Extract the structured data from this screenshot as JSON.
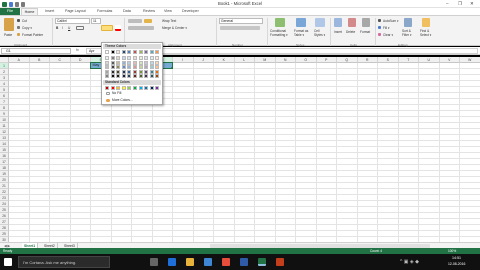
{
  "app": {
    "title": "Book1 - Microsoft Excel"
  },
  "window_controls": {
    "minimize": "–",
    "restore": "❐",
    "close": "✕"
  },
  "ribbon_tabs": [
    "File",
    "Home",
    "Insert",
    "Page Layout",
    "Formulas",
    "Data",
    "Review",
    "View",
    "Developer"
  ],
  "ribbon": {
    "clipboard": {
      "paste": "Paste",
      "cut": "Cut",
      "copy": "Copy ▾",
      "format_painter": "Format Painter",
      "group": "Clipboard"
    },
    "font": {
      "name": "Calibri",
      "size": "11",
      "bold": "B",
      "italic": "I",
      "underline": "U",
      "group": "Font"
    },
    "alignment": {
      "wrap": "Wrap Text",
      "merge": "Merge & Center ▾",
      "group": "Alignment"
    },
    "number": {
      "format": "General",
      "group": "Number"
    },
    "styles": {
      "conditional": "Conditional Formatting ▾",
      "format_table": "Format as Table ▾",
      "cell_styles": "Cell Styles ▾",
      "group": "Styles"
    },
    "cells": {
      "insert": "Insert",
      "delete": "Delete",
      "format": "Format",
      "group": "Cells"
    },
    "editing": {
      "autosum": "AutoSum ▾",
      "fill": "Fill ▾",
      "clear": "Clear ▾",
      "sort": "Sort & Filter ▾",
      "find": "Find & Select ▾",
      "group": "Editing"
    }
  },
  "formula_bar": {
    "name_box": "G1",
    "fx": "fx",
    "value": "Apr"
  },
  "columns": [
    "A",
    "B",
    "C",
    "D",
    "E",
    "F",
    "G",
    "H",
    "I",
    "J",
    "K",
    "L",
    "M",
    "N",
    "O",
    "P",
    "Q",
    "R",
    "S",
    "T",
    "U",
    "V",
    "W"
  ],
  "rows": [
    "1",
    "2",
    "3",
    "4",
    "5",
    "6",
    "7",
    "8",
    "9",
    "10",
    "11",
    "12",
    "13",
    "14",
    "15",
    "16",
    "17",
    "18",
    "19",
    "20",
    "21",
    "22",
    "23",
    "24",
    "25",
    "26",
    "27",
    "28",
    "29",
    "30"
  ],
  "cells": {
    "E1": "May",
    "F1": "Jun",
    "G1": "Jul",
    "H1": "Aug"
  },
  "palette": {
    "theme_header": "Theme Colors",
    "standard_header": "Standard Colors",
    "no_fill": "No Fill",
    "more_colors": "More Colors...",
    "theme_base": [
      "#ffffff",
      "#000000",
      "#eeece1",
      "#1f497d",
      "#4f81bd",
      "#c0504d",
      "#9bbb59",
      "#8064a2",
      "#4bacc6",
      "#f79646"
    ],
    "theme_tints": [
      [
        "#f2f2f2",
        "#7f7f7f",
        "#ddd9c3",
        "#c6d9f0",
        "#dbe5f1",
        "#f2dcdb",
        "#ebf1dd",
        "#e5e0ec",
        "#dbeef3",
        "#fdeada"
      ],
      [
        "#d8d8d8",
        "#595959",
        "#c4bd97",
        "#8db3e2",
        "#b8cce4",
        "#e5b9b7",
        "#d7e3bc",
        "#ccc1d9",
        "#b7dde8",
        "#fbd5b5"
      ],
      [
        "#bfbfbf",
        "#3f3f3f",
        "#938953",
        "#548dd4",
        "#95b3d7",
        "#d99694",
        "#c3d69b",
        "#b2a2c7",
        "#92cddc",
        "#fac08f"
      ],
      [
        "#a5a5a5",
        "#262626",
        "#494429",
        "#17365d",
        "#366092",
        "#953734",
        "#76923c",
        "#5f497a",
        "#31859b",
        "#e36c09"
      ],
      [
        "#7f7f7f",
        "#0c0c0c",
        "#1d1b10",
        "#0f243e",
        "#244061",
        "#632423",
        "#4f6128",
        "#3f3151",
        "#205867",
        "#974806"
      ]
    ],
    "standard": [
      "#c00000",
      "#ff0000",
      "#ffc000",
      "#ffff00",
      "#92d050",
      "#00b050",
      "#00b0f0",
      "#0070c0",
      "#002060",
      "#7030a0"
    ]
  },
  "sheets": [
    "Sheet1",
    "Sheet2",
    "Sheet3"
  ],
  "status": {
    "left": "Ready",
    "count": "Count: 4",
    "zoom": "100%"
  },
  "taskbar": {
    "search": "I'm Cortana. Ask me anything.",
    "time": "14:51",
    "date": "12-08-2016"
  },
  "colors": {
    "excel_green": "#217346",
    "selection": "#5c9dcc"
  }
}
